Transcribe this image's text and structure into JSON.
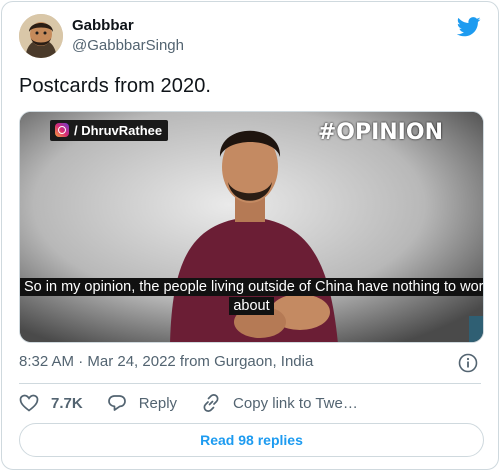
{
  "author": {
    "display_name": "Gabbbar",
    "handle": "@GabbbarSingh",
    "avatar_icon": "avatar-illustration"
  },
  "tweet": {
    "text": "Postcards from 2020."
  },
  "media": {
    "channel_tag": "/ DhruvRathee",
    "channel_icon": "instagram-icon",
    "opinion_tag": "#OPINION",
    "subtitle_line1": "So in my opinion, the people living outside of China have nothing to worr",
    "subtitle_line2": "about"
  },
  "meta": {
    "timestamp": "8:32 AM · Mar 24, 2022 from Gurgaon, India"
  },
  "actions": {
    "like_count": "7.7K",
    "reply_label": "Reply",
    "copy_label": "Copy link to Twe…"
  },
  "footer": {
    "read_replies_label": "Read 98 replies"
  },
  "colors": {
    "brand_blue": "#1d9bf0",
    "text_primary": "#0f1419",
    "text_secondary": "#536471",
    "border": "#cfd9de"
  }
}
